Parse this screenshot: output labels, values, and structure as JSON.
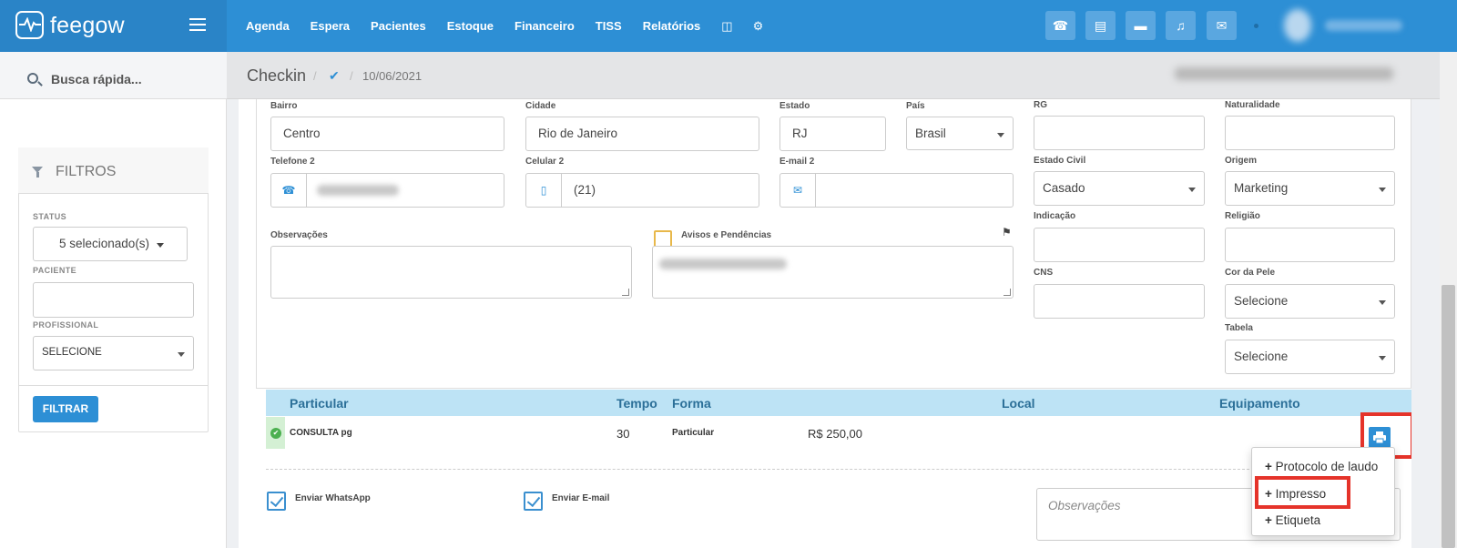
{
  "app": {
    "brand": "feegow"
  },
  "nav": {
    "items": [
      "Agenda",
      "Espera",
      "Pacientes",
      "Estoque",
      "Financeiro",
      "TISS",
      "Relatórios"
    ],
    "icons": [
      "database-icon",
      "gear-icon"
    ]
  },
  "toolbar": {
    "buttons": [
      "phone-icon",
      "inbox-icon",
      "card-icon",
      "bell-icon",
      "chat-icon"
    ]
  },
  "search": {
    "label": "Busca rápida..."
  },
  "breadcrumb": {
    "title": "Checkin",
    "sep": "/",
    "date": "10/06/2021"
  },
  "filters": {
    "title": "FILTROS",
    "status_label": "STATUS",
    "status_value": "5 selecionado(s)",
    "paciente_label": "PACIENTE",
    "paciente_value": "",
    "profissional_label": "PROFISSIONAL",
    "profissional_value": "SELECIONE",
    "button": "FILTRAR"
  },
  "form": {
    "bairro": {
      "label": "Bairro",
      "value": "Centro"
    },
    "cidade": {
      "label": "Cidade",
      "value": "Rio de Janeiro"
    },
    "estado": {
      "label": "Estado",
      "value": "RJ"
    },
    "pais": {
      "label": "País",
      "value": "Brasil"
    },
    "rg": {
      "label": "RG",
      "value": ""
    },
    "naturalidade": {
      "label": "Naturalidade",
      "value": ""
    },
    "telefone2": {
      "label": "Telefone 2"
    },
    "celular2": {
      "label": "Celular 2",
      "value": "(21)"
    },
    "email2": {
      "label": "E-mail 2",
      "value": ""
    },
    "estado_civil": {
      "label": "Estado Civil",
      "value": "Casado"
    },
    "origem": {
      "label": "Origem",
      "value": "Marketing"
    },
    "observacoes": {
      "label": "Observações"
    },
    "avisos": {
      "label": "Avisos e Pendências"
    },
    "indicacao": {
      "label": "Indicação",
      "value": ""
    },
    "religiao": {
      "label": "Religião",
      "value": ""
    },
    "cns": {
      "label": "CNS",
      "value": ""
    },
    "cor_pele": {
      "label": "Cor da Pele",
      "value": "Selecione"
    },
    "tabela": {
      "label": "Tabela",
      "value": "Selecione"
    }
  },
  "table": {
    "headers": [
      "Particular",
      "Tempo",
      "Forma",
      "Local",
      "Equipamento"
    ],
    "row": {
      "procedure": "CONSULTA pg",
      "tempo": "30",
      "forma": "Particular",
      "valor": "R$ 250,00"
    }
  },
  "options": {
    "whatsapp": "Enviar WhatsApp",
    "email": "Enviar E-mail",
    "obs_placeholder": "Observações"
  },
  "print_menu": {
    "items": [
      "Protocolo de laudo",
      "Impresso",
      "Etiqueta"
    ],
    "prefix": "+"
  },
  "colors": {
    "primary": "#2d8fd5",
    "highlight": "#e5332a",
    "table_header": "#bde3f5"
  }
}
